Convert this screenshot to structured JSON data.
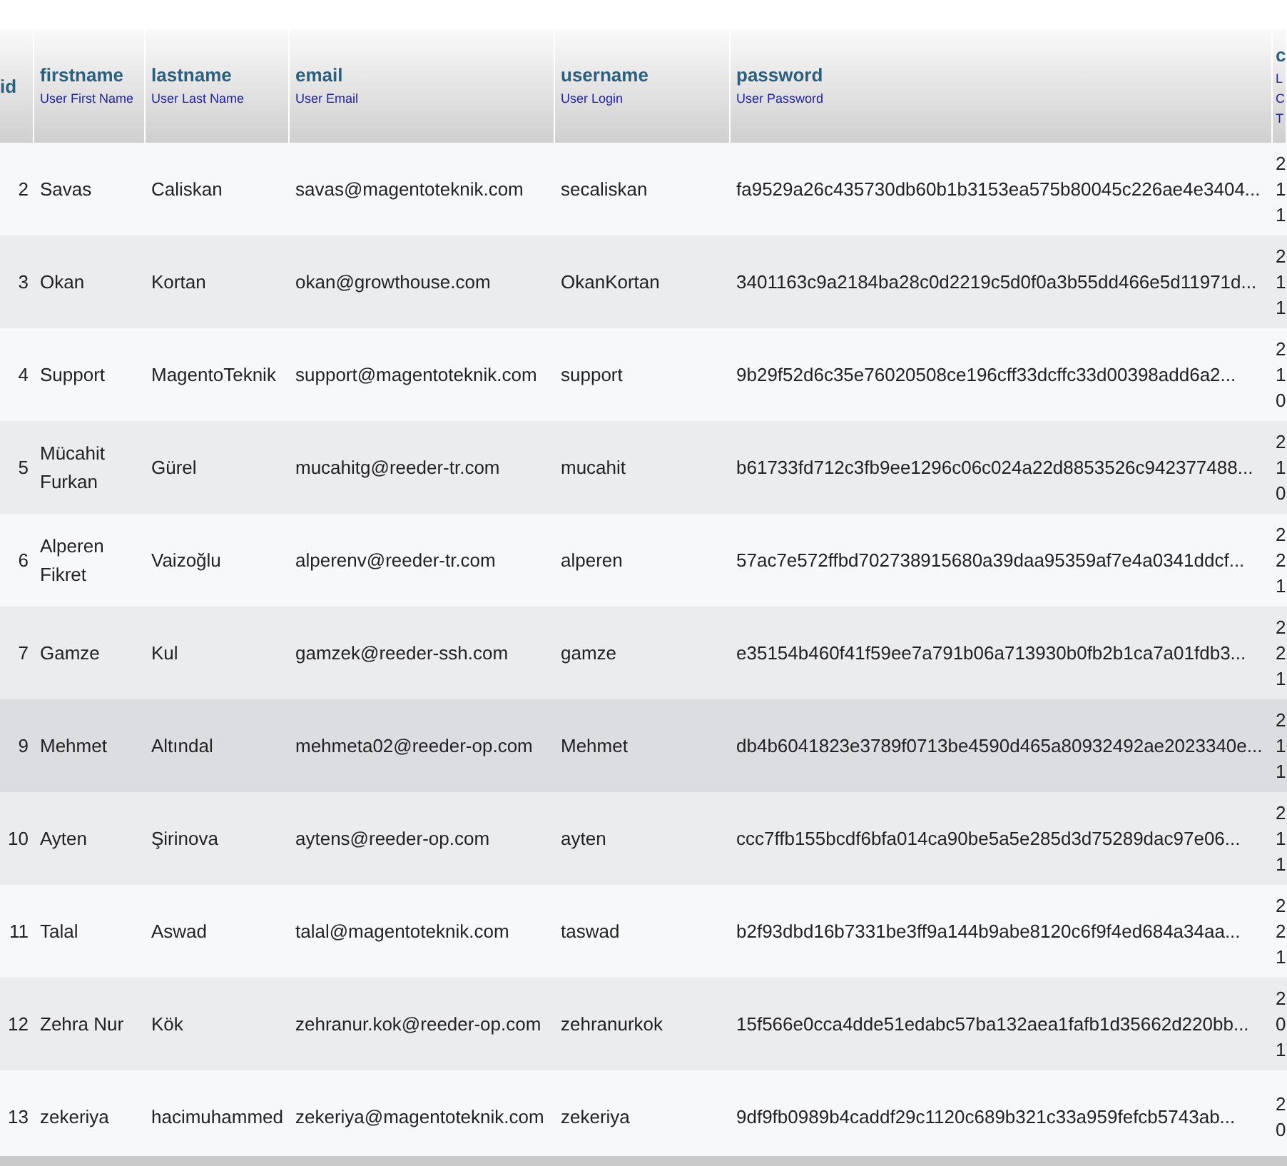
{
  "table": {
    "columns": [
      {
        "label": "id"
      },
      {
        "label": "firstname",
        "description": "User First Name"
      },
      {
        "label": "lastname",
        "description": "User Last Name"
      },
      {
        "label": "email",
        "description": "User Email"
      },
      {
        "label": "username",
        "description": "User Login"
      },
      {
        "label": "password",
        "description": "User Password"
      },
      {
        "label": "c",
        "description": "L C T"
      }
    ],
    "rows": [
      {
        "hovered": false,
        "cells": [
          "2",
          "Savas",
          "Caliskan",
          "savas@magentoteknik.com",
          "secaliskan",
          "fa9529a26c435730db60b1b3153ea575b80045c226ae4e3404...",
          "2 1 1"
        ]
      },
      {
        "hovered": false,
        "cells": [
          "3",
          "Okan",
          "Kortan",
          "okan@growthouse.com",
          "OkanKortan",
          "3401163c9a2184ba28c0d2219c5d0f0a3b55dd466e5d11971d...",
          "2 1 1"
        ]
      },
      {
        "hovered": false,
        "cells": [
          "4",
          "Support",
          "MagentoTeknik",
          "support@magentoteknik.com",
          "support",
          "9b29f52d6c35e76020508ce196cff33dcffc33d00398add6a2...",
          "2 1 0"
        ]
      },
      {
        "hovered": false,
        "cells": [
          "5",
          "Mücahit Furkan",
          "Gürel",
          "mucahitg@reeder-tr.com",
          "mucahit",
          "b61733fd712c3fb9ee1296c06c024a22d8853526c942377488...",
          "2 1 0"
        ]
      },
      {
        "hovered": false,
        "cells": [
          "6",
          "Alperen Fikret",
          "Vaizoğlu",
          "alperenv@reeder-tr.com",
          "alperen",
          "57ac7e572ffbd702738915680a39daa95359af7e4a0341ddcf...",
          "2 2 1"
        ]
      },
      {
        "hovered": false,
        "cells": [
          "7",
          "Gamze",
          "Kul",
          "gamzek@reeder-ssh.com",
          "gamze",
          "e35154b460f41f59ee7a791b06a713930b0fb2b1ca7a01fdb3...",
          "2 2 1"
        ]
      },
      {
        "hovered": true,
        "cells": [
          "9",
          "Mehmet",
          "Altındal",
          "mehmeta02@reeder-op.com",
          "Mehmet",
          "db4b6041823e3789f0713be4590d465a80932492ae2023340e...",
          "2 1 1"
        ]
      },
      {
        "hovered": false,
        "cells": [
          "10",
          "Ayten",
          "Şirinova",
          "aytens@reeder-op.com",
          "ayten",
          "ccc7ffb155bcdf6bfa014ca90be5a5e285d3d75289dac97e06...",
          "2 1 1"
        ]
      },
      {
        "hovered": false,
        "cells": [
          "11",
          "Talal",
          "Aswad",
          "talal@magentoteknik.com",
          "taswad",
          "b2f93dbd16b7331be3ff9a144b9abe8120c6f9f4ed684a34aa...",
          "2 2 1"
        ]
      },
      {
        "hovered": false,
        "cells": [
          "12",
          "Zehra Nur",
          "Kök",
          "zehranur.kok@reeder-op.com",
          "zehranurkok",
          "15f566e0cca4dde51edabc57ba132aea1fafb1d35662d220bb...",
          "2 0 1"
        ]
      },
      {
        "hovered": false,
        "cells": [
          "13",
          "zekeriya",
          "hacimuhammed",
          "zekeriya@magentoteknik.com",
          "zekeriya",
          "9df9fb0989b4caddf29c1120c689b321c33a959fefcb5743ab...",
          "2 0"
        ]
      }
    ]
  }
}
